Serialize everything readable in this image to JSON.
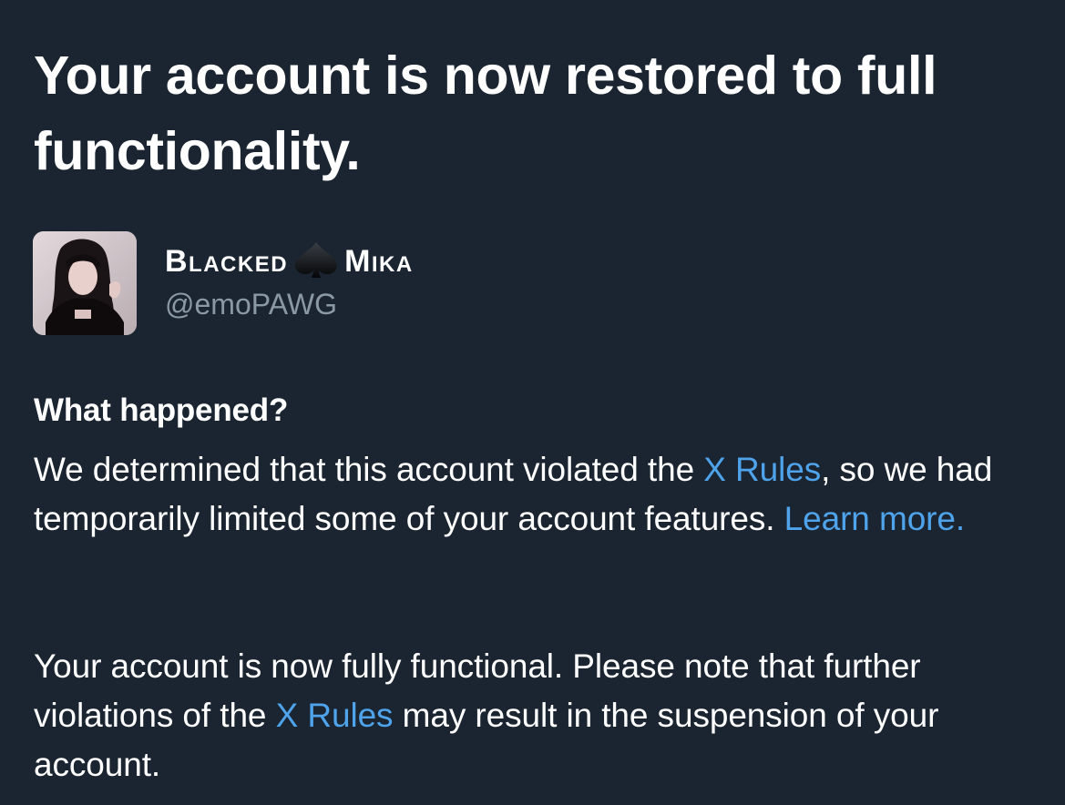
{
  "header": {
    "title": "Your account is now restored to full functionality."
  },
  "account": {
    "name_part1": "Blacked",
    "name_part2": "Mika",
    "name_icon": "spade-icon",
    "handle": "@emoPAWG",
    "avatar": "avatar-photo"
  },
  "what_happened": {
    "heading": "What happened?",
    "p1_text_before_link": "We determined that this account violated the ",
    "p1_link": "X Rules",
    "p1_text_after_link": ", so we had temporarily limited some of your account features. ",
    "p1_learn_more": "Learn more.",
    "p2_text_before_link": "Your account is now fully functional. Please note that further violations of the ",
    "p2_link": "X Rules",
    "p2_text_after_link": " may result in the suspension of your account."
  },
  "colors": {
    "background": "#1b2531",
    "text": "#ffffff",
    "link": "#4ea3ea",
    "secondary_text": "#8b98a5"
  }
}
